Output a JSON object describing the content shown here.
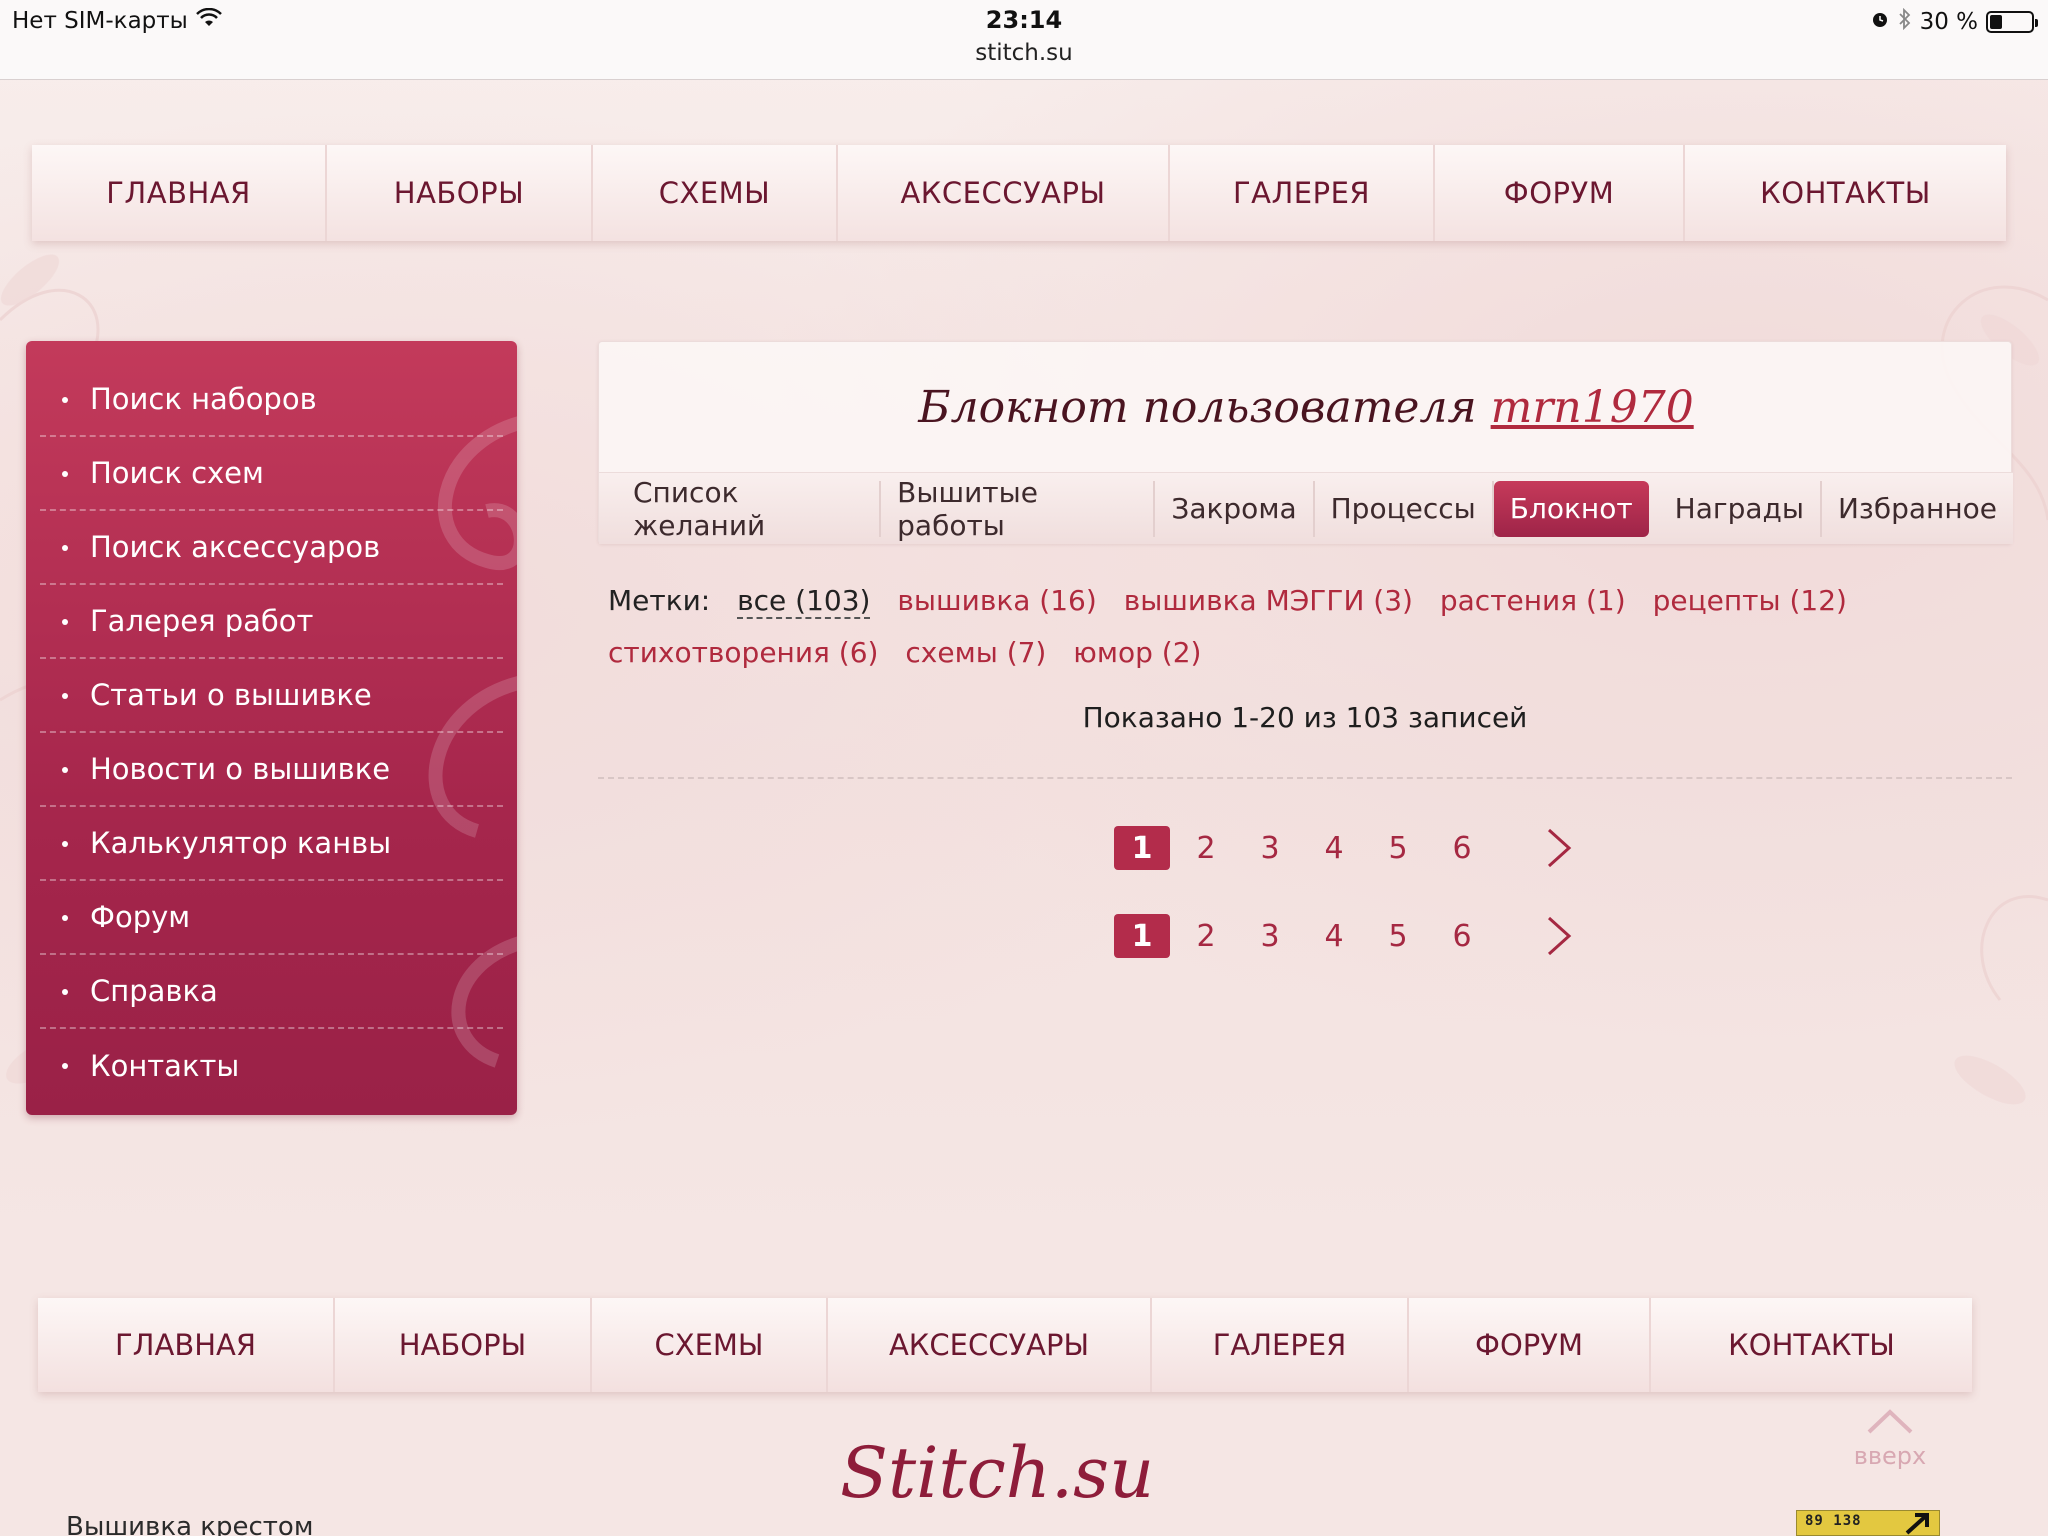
{
  "statusbar": {
    "carrier": "Нет SIM-карты",
    "time": "23:14",
    "url": "stitch.su",
    "battery": "30 %",
    "battery_level": 0.3
  },
  "topnav": [
    {
      "label": "ГЛАВНАЯ"
    },
    {
      "label": "НАБОРЫ"
    },
    {
      "label": "СХЕМЫ"
    },
    {
      "label": "АКСЕССУАРЫ"
    },
    {
      "label": "ГАЛЕРЕЯ"
    },
    {
      "label": "ФОРУМ"
    },
    {
      "label": "КОНТАКТЫ"
    }
  ],
  "sidebar": {
    "items": [
      {
        "label": "Поиск наборов"
      },
      {
        "label": "Поиск схем"
      },
      {
        "label": "Поиск аксессуаров"
      },
      {
        "label": "Галерея работ"
      },
      {
        "label": "Статьи о вышивке"
      },
      {
        "label": "Новости о вышивке"
      },
      {
        "label": "Калькулятор канвы"
      },
      {
        "label": "Форум"
      },
      {
        "label": "Справка"
      },
      {
        "label": "Контакты"
      }
    ]
  },
  "notebook": {
    "title_prefix": "Блокнот пользователя",
    "username": "mrn1970",
    "tabs": [
      {
        "label": "Список желаний",
        "active": false
      },
      {
        "label": "Вышитые работы",
        "active": false
      },
      {
        "label": "Закрома",
        "active": false
      },
      {
        "label": "Процессы",
        "active": false
      },
      {
        "label": "Блокнот",
        "active": true
      },
      {
        "label": "Награды",
        "active": false
      },
      {
        "label": "Избранное",
        "active": false
      }
    ],
    "tags_label": "Метки:",
    "tags": [
      {
        "label": "все (103)",
        "current": true
      },
      {
        "label": "вышивка (16)",
        "current": false
      },
      {
        "label": "вышивка МЭГГИ (3)",
        "current": false
      },
      {
        "label": "растения (1)",
        "current": false
      },
      {
        "label": "рецепты (12)",
        "current": false
      },
      {
        "label": "стихотворения (6)",
        "current": false
      },
      {
        "label": "схемы (7)",
        "current": false
      },
      {
        "label": "юмор (2)",
        "current": false
      }
    ],
    "shown_text": "Показано 1-20 из 103 записей",
    "pages": [
      "1",
      "2",
      "3",
      "4",
      "5",
      "6"
    ],
    "current_page": "1"
  },
  "bottomnav": [
    {
      "label": "ГЛАВНАЯ"
    },
    {
      "label": "НАБОРЫ"
    },
    {
      "label": "СХЕМЫ"
    },
    {
      "label": "АКСЕССУАРЫ"
    },
    {
      "label": "ГАЛЕРЕЯ"
    },
    {
      "label": "ФОРУМ"
    },
    {
      "label": "КОНТАКТЫ"
    }
  ],
  "footer": {
    "up_label": "вверх",
    "logo": "Stitch.su",
    "text": "Вышивка крестом",
    "counter": "89 138"
  },
  "colors": {
    "accent": "#b32c4b",
    "nav_text": "#6b1730",
    "link": "#b02a3e"
  },
  "icons": {
    "wifi": "wifi-icon",
    "alarm": "alarm-icon",
    "bluetooth": "bluetooth-icon",
    "battery": "battery-icon",
    "next": "chevron-right-icon",
    "up": "chevron-up-icon"
  }
}
